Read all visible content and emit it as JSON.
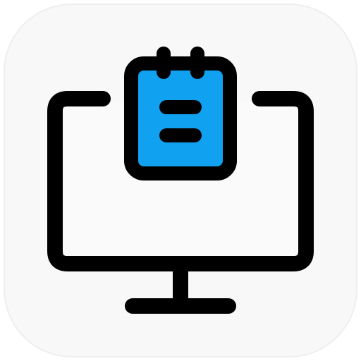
{
  "icon": {
    "name": "desktop-notepad-icon",
    "colors": {
      "tile_background": "#f8f8f8",
      "tile_border": "#eeeeee",
      "stroke": "#000000",
      "notepad_fill": "#10a2f0",
      "screen_fill": "#fafafa"
    }
  }
}
